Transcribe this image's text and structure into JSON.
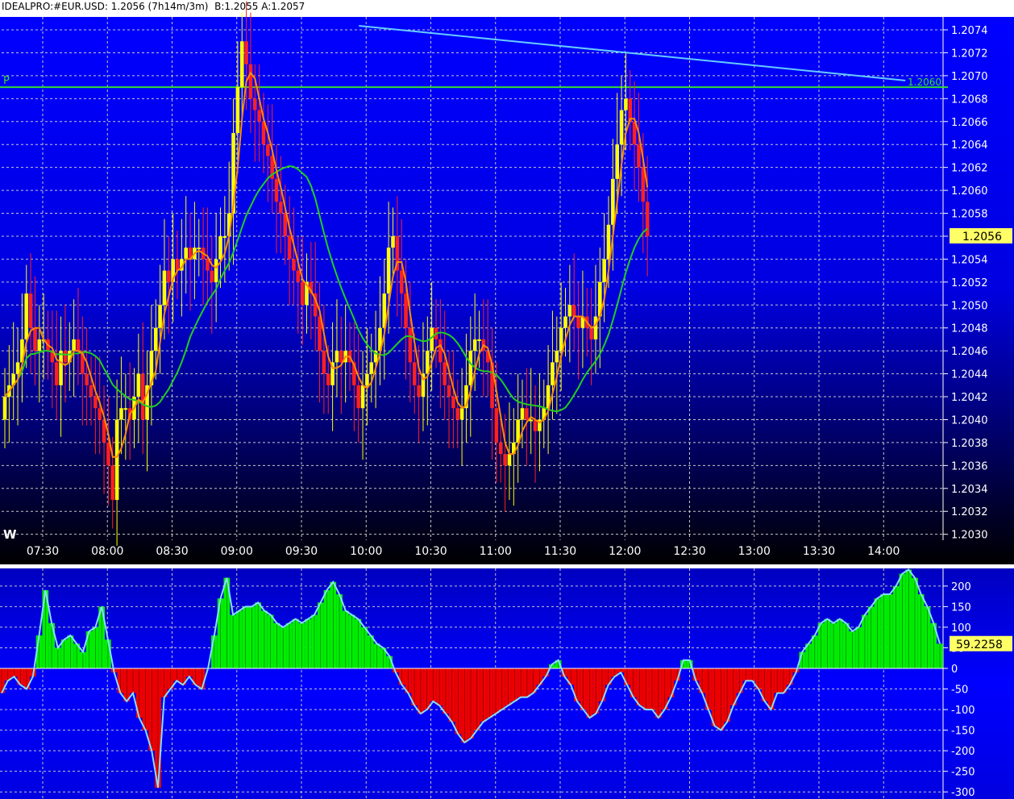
{
  "header": {
    "symbol": "IDEALPRO:#EUR.USD: 1.2056 (7h14m/3m)",
    "bid_ask": "B:1.2055 A:1.2057"
  },
  "colors": {
    "bg_top": "#0000ff",
    "bg_bottom": "#000000",
    "grid": "#c8c8c8",
    "up_candle": "#ffff00",
    "down_candle": "#ff2020",
    "ma_fast": "#ff8c00",
    "ma_slow": "#22cc22",
    "pivot_line": "#33dd33",
    "trend_line": "#66ccff",
    "osc_pos": "#00ee00",
    "osc_neg": "#ee0000",
    "osc_outline": "#88ddff"
  },
  "chart_data": [
    {
      "type": "candlestick",
      "title": "",
      "y_ticks": [
        "1.2074",
        "1.2072",
        "1.2070",
        "1.2068",
        "1.2066",
        "1.2064",
        "1.2062",
        "1.2060",
        "1.2058",
        "1.2056",
        "1.2054",
        "1.2052",
        "1.2050",
        "1.2048",
        "1.2046",
        "1.2044",
        "1.2042",
        "1.2040",
        "1.2038",
        "1.2036",
        "1.2034",
        "1.2032",
        "1.2030"
      ],
      "ylim": [
        1.2029,
        1.2075
      ],
      "x_ticks": [
        "07:30",
        "08:00",
        "08:30",
        "09:00",
        "09:30",
        "10:00",
        "10:30",
        "11:00",
        "11:30",
        "12:00",
        "12:30",
        "13:00",
        "13:30",
        "14:00"
      ],
      "last_price_label": "1.2056",
      "last_price": 1.2056,
      "pivot_label": "P",
      "pivot_level": 1.2069,
      "pivot_value_label": "1.2060",
      "corner_label": "W",
      "trend_line": [
        [
          10.0,
          1.2074
        ],
        [
          14.0,
          1.207
        ]
      ],
      "close": [
        1.2042,
        1.2043,
        1.2044,
        1.2045,
        1.2047,
        1.2051,
        1.2048,
        1.2046,
        1.2047,
        1.2047,
        1.2046,
        1.2045,
        1.2043,
        1.2046,
        1.2045,
        1.2046,
        1.2047,
        1.2046,
        1.2044,
        1.2043,
        1.2042,
        1.2041,
        1.204,
        1.2038,
        1.2036,
        1.2033,
        1.204,
        1.2041,
        1.2041,
        1.204,
        1.2042,
        1.2044,
        1.204,
        1.2043,
        1.2046,
        1.2048,
        1.205,
        1.2053,
        1.2052,
        1.2054,
        1.2053,
        1.2054,
        1.2055,
        1.2054,
        1.2055,
        1.2055,
        1.2054,
        1.2053,
        1.2052,
        1.2054,
        1.2056,
        1.2056,
        1.2058,
        1.2065,
        1.2069,
        1.2073,
        1.2071,
        1.2068,
        1.2067,
        1.2066,
        1.2064,
        1.2063,
        1.2061,
        1.2059,
        1.2058,
        1.2056,
        1.2054,
        1.2053,
        1.2052,
        1.205,
        1.2052,
        1.2051,
        1.2049,
        1.2046,
        1.2044,
        1.2043,
        1.2045,
        1.2046,
        1.2045,
        1.2046,
        1.2045,
        1.2043,
        1.2041,
        1.2043,
        1.2044,
        1.2045,
        1.2046,
        1.2048,
        1.2051,
        1.2055,
        1.2056,
        1.2053,
        1.2051,
        1.2048,
        1.2045,
        1.2043,
        1.2042,
        1.2044,
        1.2046,
        1.2048,
        1.2047,
        1.2045,
        1.2043,
        1.2042,
        1.2041,
        1.204,
        1.2041,
        1.2043,
        1.2046,
        1.2047,
        1.2047,
        1.2046,
        1.2045,
        1.2041,
        1.2038,
        1.2037,
        1.2036,
        1.2037,
        1.2038,
        1.204,
        1.2041,
        1.204,
        1.204,
        1.2039,
        1.204,
        1.2041,
        1.2043,
        1.2045,
        1.2046,
        1.2048,
        1.2049,
        1.205,
        1.2049,
        1.2048,
        1.2049,
        1.2048,
        1.2047,
        1.2049,
        1.2052,
        1.2054,
        1.2057,
        1.2061,
        1.2064,
        1.2067,
        1.2068,
        1.2066,
        1.2064,
        1.2062,
        1.2059,
        1.2056
      ]
    },
    {
      "type": "bar",
      "title": "",
      "y_ticks": [
        "200",
        "150",
        "100",
        "50",
        "0",
        "-50",
        "-100",
        "-150",
        "-200",
        "-250",
        "-300"
      ],
      "ylim": [
        -305,
        235
      ],
      "last_value_label": "59.2258",
      "last_value": 59.2258,
      "values": [
        -60,
        -30,
        -20,
        -40,
        -50,
        -20,
        80,
        190,
        110,
        50,
        70,
        80,
        60,
        40,
        90,
        100,
        150,
        70,
        -10,
        -60,
        -80,
        -60,
        -120,
        -150,
        -200,
        -290,
        -70,
        -50,
        -30,
        -40,
        -20,
        -40,
        -50,
        0,
        80,
        170,
        220,
        130,
        140,
        150,
        150,
        160,
        140,
        130,
        110,
        100,
        110,
        120,
        110,
        120,
        130,
        160,
        190,
        210,
        180,
        140,
        130,
        120,
        100,
        80,
        60,
        50,
        30,
        -10,
        -40,
        -60,
        -90,
        -110,
        -100,
        -80,
        -90,
        -110,
        -130,
        -160,
        -180,
        -170,
        -150,
        -130,
        -120,
        -110,
        -100,
        -90,
        -80,
        -70,
        -70,
        -60,
        -40,
        -20,
        10,
        20,
        -20,
        -40,
        -80,
        -100,
        -120,
        -110,
        -80,
        -40,
        -20,
        -10,
        -40,
        -70,
        -90,
        -100,
        -100,
        -120,
        -100,
        -70,
        -30,
        20,
        20,
        -30,
        -60,
        -100,
        -140,
        -150,
        -130,
        -90,
        -60,
        -30,
        -30,
        -50,
        -80,
        -100,
        -60,
        -60,
        -40,
        -10,
        40,
        60,
        80,
        110,
        120,
        110,
        120,
        110,
        90,
        100,
        130,
        150,
        170,
        180,
        180,
        200,
        230,
        240,
        220,
        180,
        150,
        110,
        60
      ]
    }
  ]
}
